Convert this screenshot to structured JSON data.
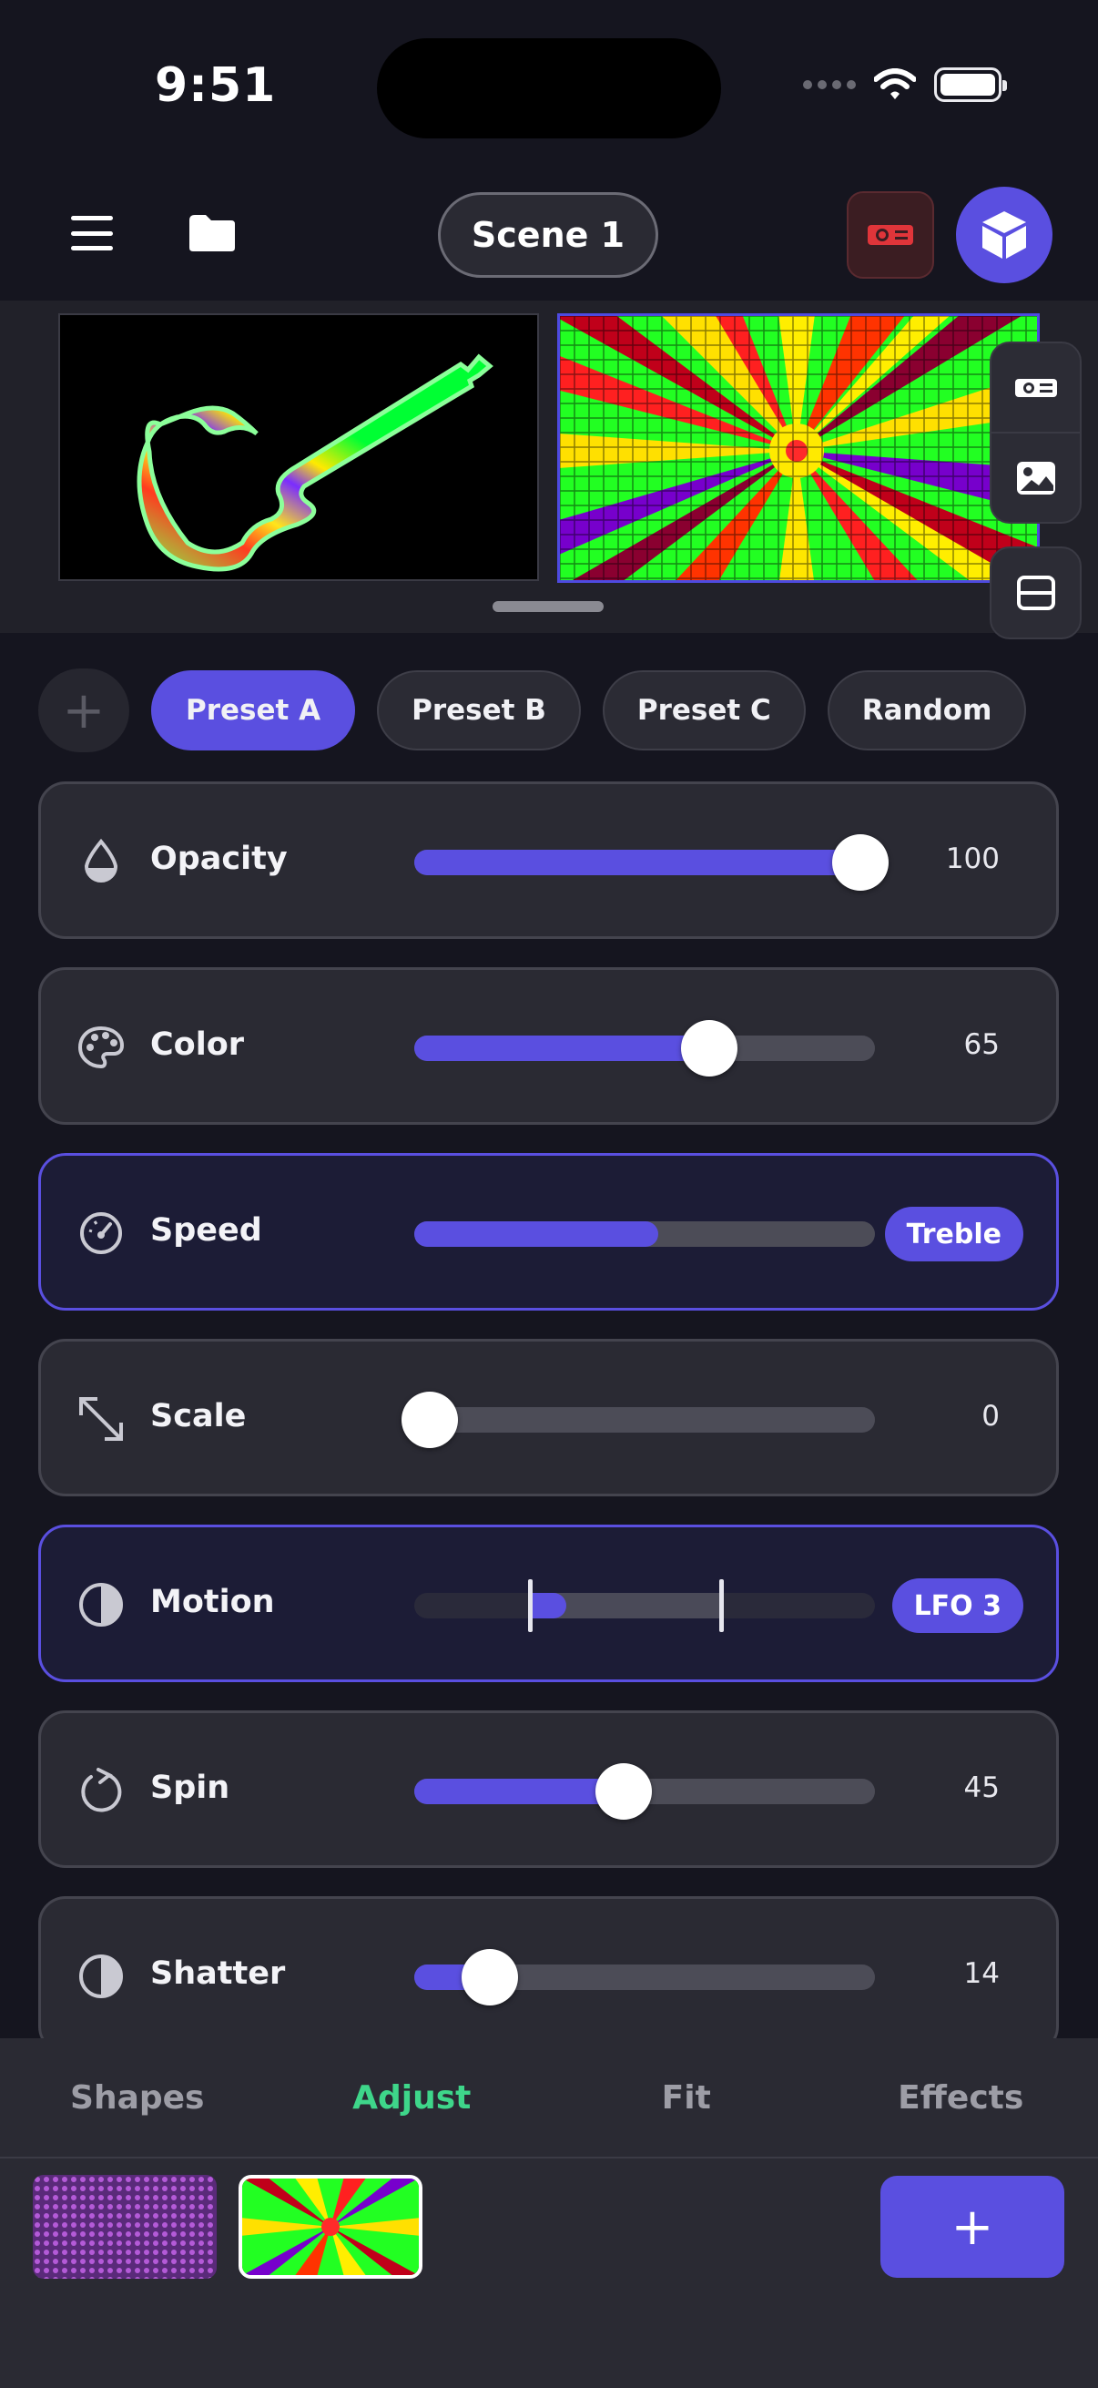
{
  "status": {
    "time": "9:51"
  },
  "header": {
    "scene_label": "Scene 1"
  },
  "presets": {
    "items": [
      "Preset A",
      "Preset B",
      "Preset C",
      "Random"
    ],
    "active": "Preset A"
  },
  "controls": [
    {
      "label": "Opacity",
      "value": "100",
      "level": 1.0,
      "icon": "opacity-drop-icon"
    },
    {
      "label": "Color",
      "value": "65",
      "level": 0.65,
      "icon": "palette-icon"
    },
    {
      "label": "Speed",
      "badge": "Treble",
      "level": 0.53,
      "icon": "speed-gauge-icon"
    },
    {
      "label": "Scale",
      "value": "0",
      "level": 0.0,
      "icon": "scale-arrows-icon"
    },
    {
      "label": "Motion",
      "badge": "LFO 3",
      "icon": "half-circle-icon"
    },
    {
      "label": "Spin",
      "value": "45",
      "level": 0.45,
      "icon": "rotate-icon"
    },
    {
      "label": "Shatter",
      "value": "14",
      "level": 0.14,
      "icon": "half-circle-icon"
    }
  ],
  "tabs": [
    "Shapes",
    "Adjust",
    "Fit",
    "Effects"
  ],
  "active_tab": "Adjust",
  "add_layer_label": "+",
  "colors": {
    "accent": "#5a4fe0",
    "tab_active": "#3ed68a"
  }
}
